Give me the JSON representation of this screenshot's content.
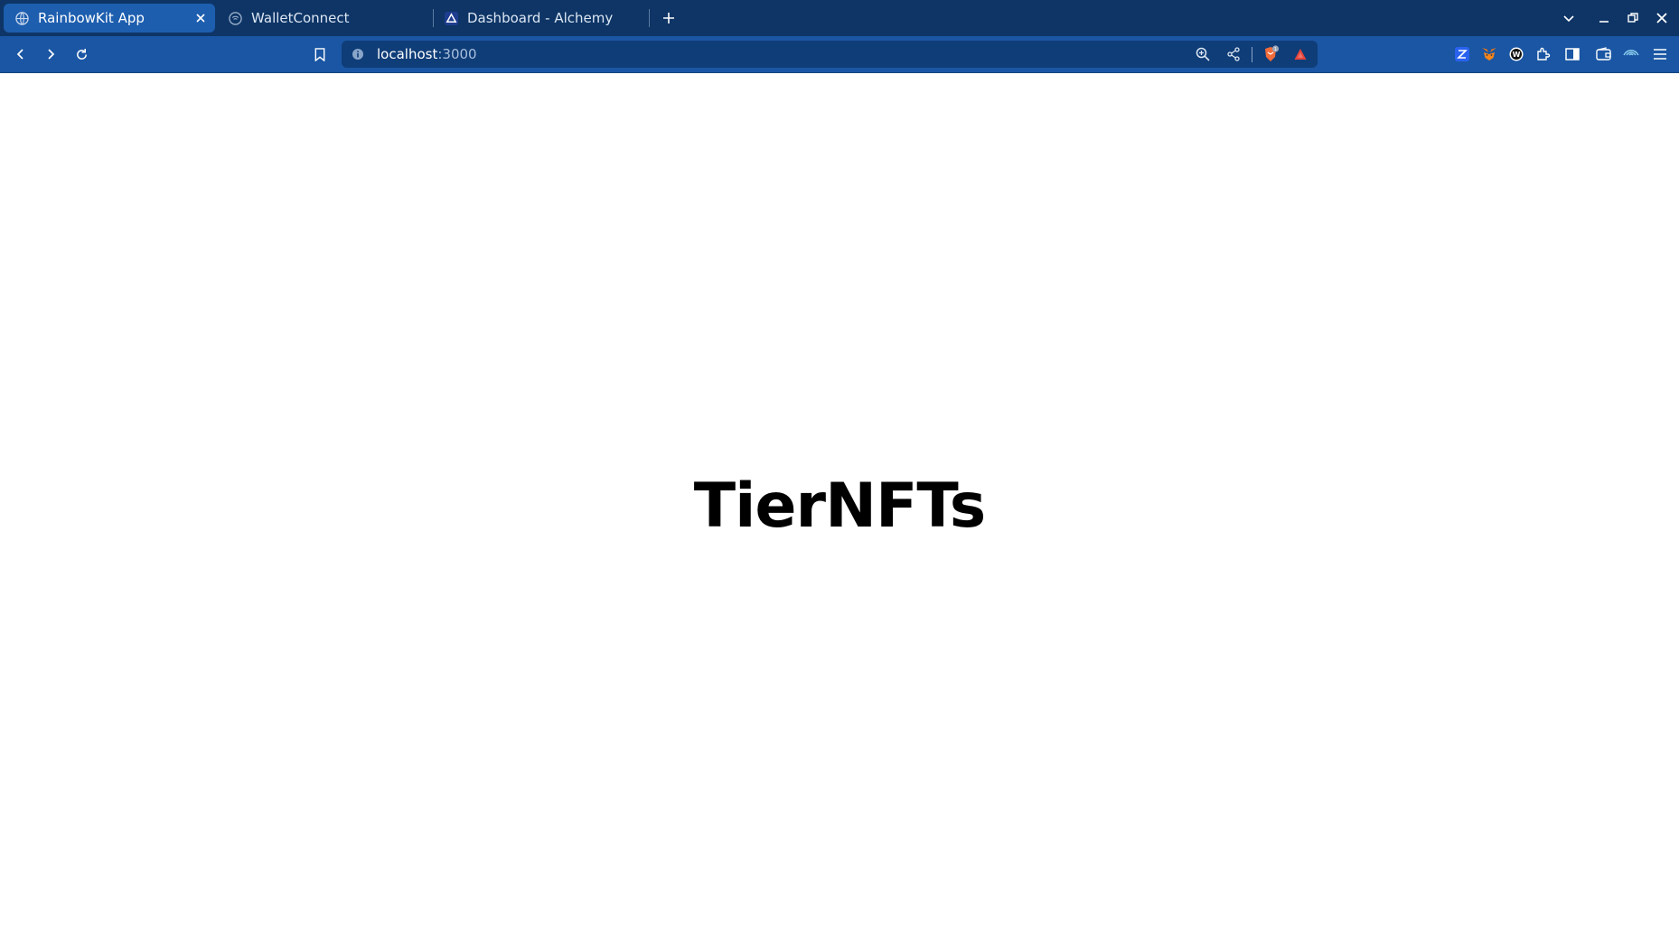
{
  "browser": {
    "tabs": [
      {
        "label": "RainbowKit App",
        "active": true,
        "icon": "globe-icon"
      },
      {
        "label": "WalletConnect",
        "active": false,
        "icon": "walletconnect-icon"
      },
      {
        "label": "Dashboard - Alchemy",
        "active": false,
        "icon": "alchemy-icon"
      }
    ],
    "address": {
      "host": "localhost",
      "port": ":3000"
    },
    "extensions": [
      "zerion-extension-icon",
      "metamask-extension-icon",
      "wallet-extension-icon",
      "extensions-puzzle-icon",
      "sidebar-icon",
      "brave-wallet-icon",
      "vpn-icon",
      "menu-icon"
    ],
    "colors": {
      "tabstrip": "#0e3566",
      "toolbar": "#1a56a3",
      "active_tab": "#1d5eaf",
      "urlbar": "#0f3d78"
    },
    "shields_badge": "1"
  },
  "page": {
    "title": "TierNFTs"
  }
}
